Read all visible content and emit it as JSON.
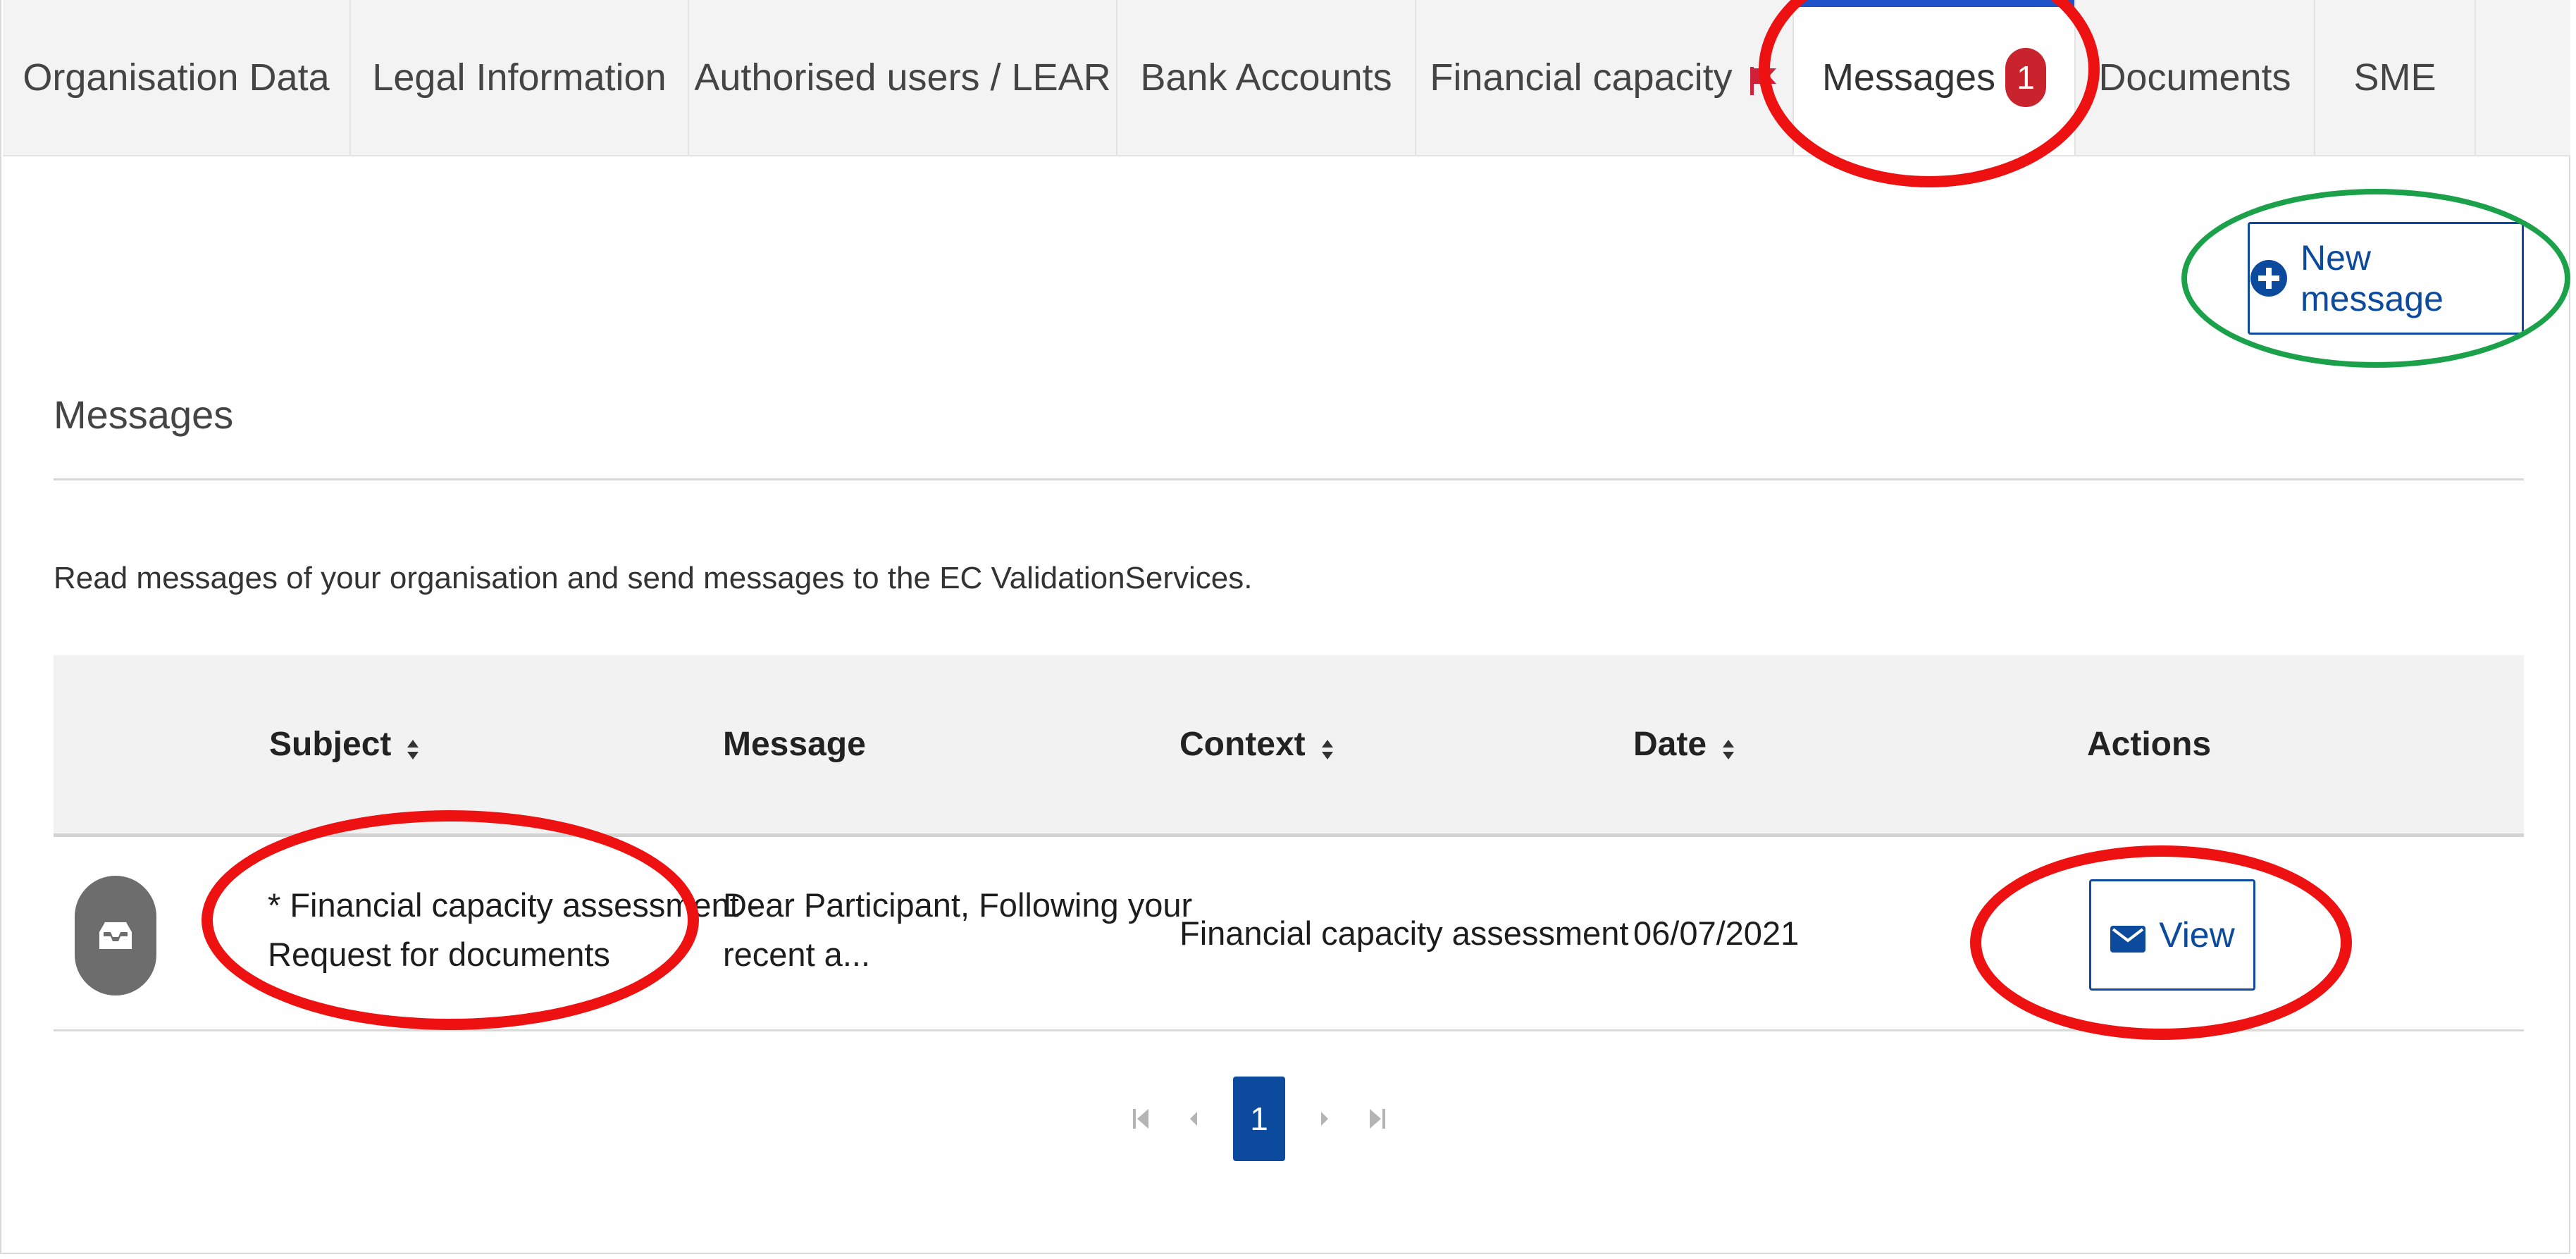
{
  "tabs": [
    {
      "label": "Organisation Data"
    },
    {
      "label": "Legal Information"
    },
    {
      "label": "Authorised users / LEAR"
    },
    {
      "label": "Bank Accounts"
    },
    {
      "label": "Financial capacity",
      "icon": "flag-icon",
      "icon_color": "#d0213a"
    },
    {
      "label": "Messages",
      "badge": "1",
      "active": true
    },
    {
      "label": "Documents"
    },
    {
      "label": "SME"
    }
  ],
  "new_message_button": {
    "label": "New message",
    "icon": "plus-circle-icon"
  },
  "section": {
    "title": "Messages",
    "intro": "Read messages of your organisation and send messages to the EC ValidationServices."
  },
  "table": {
    "columns": {
      "subject": "Subject",
      "message": "Message",
      "context": "Context",
      "date": "Date",
      "actions": "Actions"
    },
    "rows": [
      {
        "icon": "inbox-icon",
        "subject_line1": "* Financial capacity assessment -",
        "subject_line2": "Request for documents",
        "message_line1": "Dear Participant, Following your",
        "message_line2": "recent a...",
        "context": "Financial capacity assessment",
        "date": "06/07/2021",
        "action_label": "View",
        "action_icon": "envelope-icon"
      }
    ]
  },
  "pagination": {
    "current_page": "1"
  },
  "colors": {
    "primary": "#0b4a9c",
    "badge": "#c9232d",
    "annotation_red": "#ee1111",
    "annotation_green": "#1aa14a",
    "active_tab_indicator": "#1f54c9"
  }
}
